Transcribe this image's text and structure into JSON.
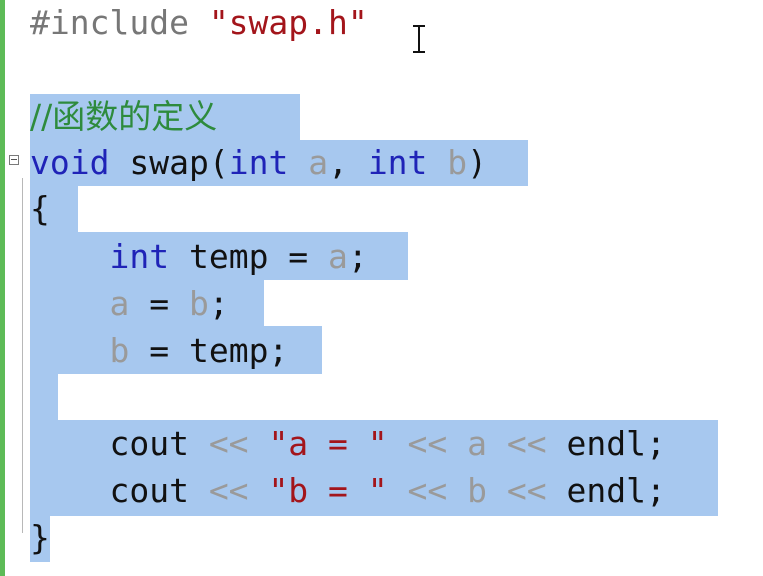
{
  "editor": {
    "lines": [
      {
        "id": "include",
        "tokens": [
          {
            "cls": "pre",
            "t": "#include "
          },
          {
            "cls": "str",
            "t": "\"swap.h\""
          }
        ]
      },
      {
        "id": "blank1",
        "tokens": []
      },
      {
        "id": "comment",
        "tokens": [
          {
            "cls": "cmt",
            "t": "//函数的定义"
          }
        ]
      },
      {
        "id": "signature",
        "tokens": [
          {
            "cls": "kw",
            "t": "void"
          },
          {
            "cls": "plain",
            "t": " swap("
          },
          {
            "cls": "kw",
            "t": "int"
          },
          {
            "cls": "plain",
            "t": " "
          },
          {
            "cls": "par",
            "t": "a"
          },
          {
            "cls": "plain",
            "t": ", "
          },
          {
            "cls": "kw",
            "t": "int"
          },
          {
            "cls": "plain",
            "t": " "
          },
          {
            "cls": "par",
            "t": "b"
          },
          {
            "cls": "plain",
            "t": ")"
          }
        ]
      },
      {
        "id": "open-brace",
        "tokens": [
          {
            "cls": "plain",
            "t": "{"
          }
        ]
      },
      {
        "id": "temp-decl",
        "tokens": [
          {
            "cls": "plain",
            "t": "    "
          },
          {
            "cls": "kw",
            "t": "int"
          },
          {
            "cls": "plain",
            "t": " temp = "
          },
          {
            "cls": "par",
            "t": "a"
          },
          {
            "cls": "plain",
            "t": ";"
          }
        ]
      },
      {
        "id": "assign-a",
        "tokens": [
          {
            "cls": "plain",
            "t": "    "
          },
          {
            "cls": "par",
            "t": "a"
          },
          {
            "cls": "plain",
            "t": " = "
          },
          {
            "cls": "par",
            "t": "b"
          },
          {
            "cls": "plain",
            "t": ";"
          }
        ]
      },
      {
        "id": "assign-b",
        "tokens": [
          {
            "cls": "plain",
            "t": "    "
          },
          {
            "cls": "par",
            "t": "b"
          },
          {
            "cls": "plain",
            "t": " = temp;"
          }
        ]
      },
      {
        "id": "blank2",
        "tokens": []
      },
      {
        "id": "cout-a",
        "tokens": [
          {
            "cls": "plain",
            "t": "    cout "
          },
          {
            "cls": "op",
            "t": "<<"
          },
          {
            "cls": "plain",
            "t": " "
          },
          {
            "cls": "str",
            "t": "\"a = \""
          },
          {
            "cls": "plain",
            "t": " "
          },
          {
            "cls": "op",
            "t": "<<"
          },
          {
            "cls": "plain",
            "t": " "
          },
          {
            "cls": "par",
            "t": "a"
          },
          {
            "cls": "plain",
            "t": " "
          },
          {
            "cls": "op",
            "t": "<<"
          },
          {
            "cls": "plain",
            "t": " endl;"
          }
        ]
      },
      {
        "id": "cout-b",
        "tokens": [
          {
            "cls": "plain",
            "t": "    cout "
          },
          {
            "cls": "op",
            "t": "<<"
          },
          {
            "cls": "plain",
            "t": " "
          },
          {
            "cls": "str",
            "t": "\"b = \""
          },
          {
            "cls": "plain",
            "t": " "
          },
          {
            "cls": "op",
            "t": "<<"
          },
          {
            "cls": "plain",
            "t": " "
          },
          {
            "cls": "par",
            "t": "b"
          },
          {
            "cls": "plain",
            "t": " "
          },
          {
            "cls": "op",
            "t": "<<"
          },
          {
            "cls": "plain",
            "t": " endl;"
          }
        ]
      },
      {
        "id": "close-brace",
        "tokens": [
          {
            "cls": "plain",
            "t": "}"
          }
        ]
      }
    ]
  },
  "colors": {
    "selection": "#a7c8ef",
    "keyword": "#1f23b7",
    "string": "#a3151b",
    "comment": "#2e8b3d",
    "parameter": "#9a9a9a",
    "change_bar": "#5dbb57"
  },
  "icons": [
    "fold-collapse-icon",
    "text-cursor-icon"
  ]
}
